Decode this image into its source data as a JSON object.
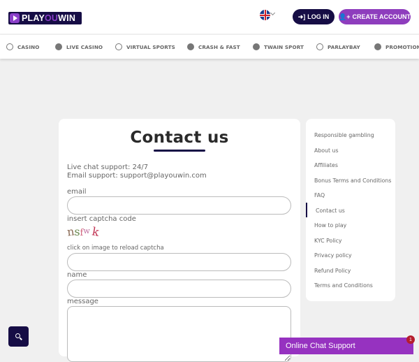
{
  "header": {
    "logo": {
      "play": "PLAY",
      "ou": "OU",
      "win": "WIN"
    },
    "language": "English (UK)",
    "login_label": "LOG IN",
    "create_account_label": "CREATE ACCOUNT"
  },
  "nav": {
    "items": [
      {
        "label": "CASINO",
        "icon": "casino-chip-icon"
      },
      {
        "label": "LIVE CASINO",
        "icon": "live-casino-icon"
      },
      {
        "label": "VIRTUAL SPORTS",
        "icon": "virtual-sports-icon"
      },
      {
        "label": "CRASH & FAST",
        "icon": "rocket-icon"
      },
      {
        "label": "TWAIN SPORT",
        "icon": "twain-sport-icon"
      },
      {
        "label": "PARLAYBAY",
        "icon": "parlaybay-icon"
      },
      {
        "label": "PROMOTIONS",
        "icon": "gift-icon"
      }
    ]
  },
  "contact": {
    "title": "Contact us",
    "live_chat": "Live chat support: 24/7",
    "email_support": "Email support: support@playouwin.com",
    "email_label": "email",
    "captcha_label": "insert captcha code",
    "captcha_chars": [
      "n",
      "s",
      "f",
      "w",
      "k"
    ],
    "captcha_hint": "click on image to reload captcha",
    "name_label": "name",
    "message_label": "message",
    "email_value": "",
    "captcha_value": "",
    "name_value": "",
    "message_value": ""
  },
  "sidebar": {
    "items": [
      {
        "label": "Responsible gambling"
      },
      {
        "label": "About us"
      },
      {
        "label": "Affiliates"
      },
      {
        "label": "Bonus Terms and Conditions"
      },
      {
        "label": "FAQ"
      },
      {
        "label": "Contact us",
        "active": true
      },
      {
        "label": "How to play"
      },
      {
        "label": "KYC Policy"
      },
      {
        "label": "Privacy policy"
      },
      {
        "label": "Refund Policy"
      },
      {
        "label": "Terms and Conditions"
      }
    ]
  },
  "chat_widget": {
    "label": "Online Chat Support",
    "badge": "1"
  },
  "colors": {
    "brand_dark": "#160d45",
    "brand_purple": "#8e3dbd",
    "chat_purple": "#9632c0",
    "badge_red": "#b51d2d"
  }
}
